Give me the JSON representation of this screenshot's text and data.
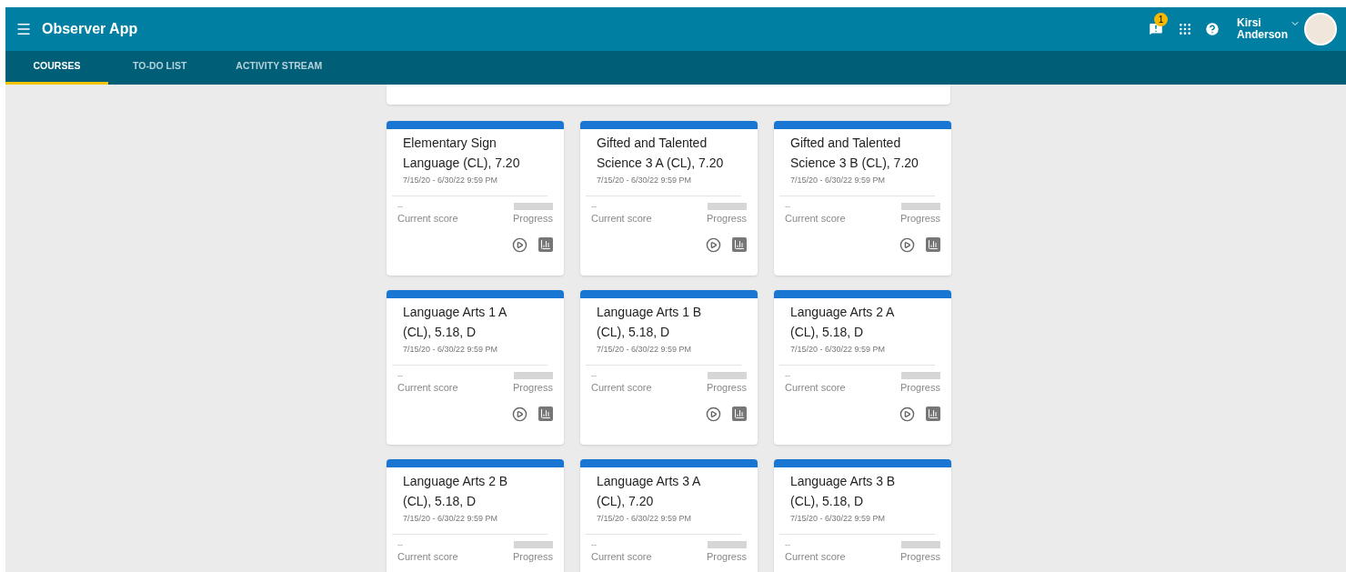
{
  "app_bar": {
    "title": "Observer App",
    "notifications_badge": "1",
    "user_name": "Kirsi Anderson"
  },
  "tabs": [
    {
      "label": "COURSES",
      "selected": true
    },
    {
      "label": "TO-DO LIST",
      "selected": false
    },
    {
      "label": "ACTIVITY STREAM",
      "selected": false
    }
  ],
  "courses": [
    {
      "title": "Elementary Sign Language (CL), 7.20",
      "dates": "7/15/20 - 6/30/22 9:59 PM",
      "level": 0,
      "score": "--",
      "score_label": "Current score",
      "progress_label": "Progress"
    },
    {
      "title": "Gifted and Talented Science 3 A (CL), 7.20",
      "dates": "7/15/20 - 6/30/22 9:59 PM",
      "level": 0,
      "score": "--",
      "score_label": "Current score",
      "progress_label": "Progress"
    },
    {
      "title": "Gifted and Talented Science 3 B (CL), 7.20",
      "dates": "7/15/20 - 6/30/22 9:59 PM",
      "level": 0,
      "score": "--",
      "score_label": "Current score",
      "progress_label": "Progress"
    },
    {
      "title": "Language Arts 1 A (CL), 5.18, D",
      "dates": "7/15/20 - 6/30/22 9:59 PM",
      "level": 0,
      "score": "--",
      "score_label": "Current score",
      "progress_label": "Progress"
    },
    {
      "title": "Language Arts 1 B (CL), 5.18, D",
      "dates": "7/15/20 - 6/30/22 9:59 PM",
      "level": 0,
      "score": "--",
      "score_label": "Current score",
      "progress_label": "Progress"
    },
    {
      "title": "Language Arts 2 A (CL), 5.18, D",
      "dates": "7/15/20 - 6/30/22 9:59 PM",
      "level": 0,
      "score": "--",
      "score_label": "Current score",
      "progress_label": "Progress"
    },
    {
      "title": "Language Arts 2 B (CL), 5.18, D",
      "dates": "7/15/20 - 6/30/22 9:59 PM",
      "level": 0,
      "score": "--",
      "score_label": "Current score",
      "progress_label": "Progress"
    },
    {
      "title": "Language Arts 3 A (CL), 7.20",
      "dates": "7/15/20 - 6/30/22 9:59 PM",
      "level": 0,
      "score": "--",
      "score_label": "Current score",
      "progress_label": "Progress"
    },
    {
      "title": "Language Arts 3 B (CL), 5.18, D",
      "dates": "7/15/20 - 6/30/22 9:59 PM",
      "level": 0,
      "score": "--",
      "score_label": "Current score",
      "progress_label": "Progress"
    }
  ]
}
